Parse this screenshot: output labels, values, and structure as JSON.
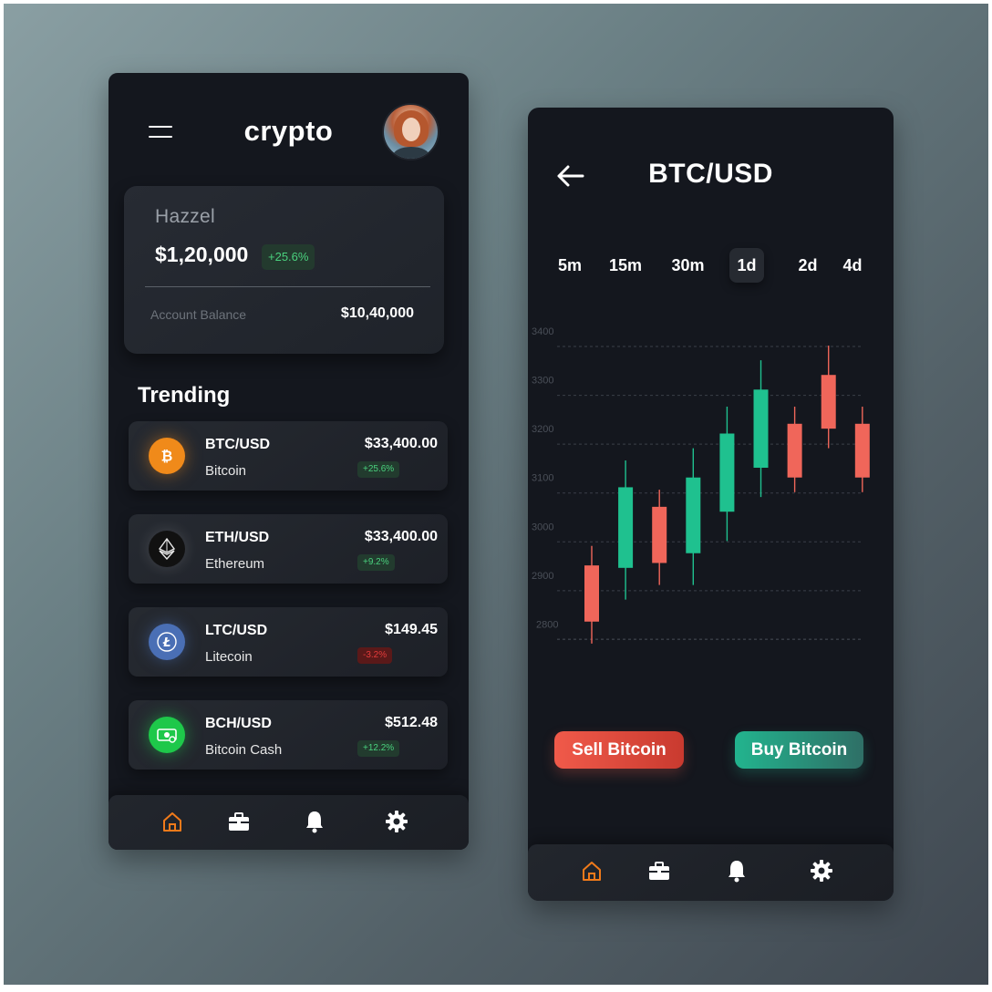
{
  "home": {
    "app_title": "crypto",
    "user_name": "Hazzel",
    "total_amount": "$1,20,000",
    "total_change": "+25.6%",
    "balance_label": "Account Balance",
    "balance_value": "$10,40,000",
    "section_title": "Trending",
    "coins": [
      {
        "pair": "BTC/USD",
        "name": "Bitcoin",
        "price": "$33,400.00",
        "change": "+25.6%",
        "direction": "up",
        "icon": "bitcoin-icon"
      },
      {
        "pair": "ETH/USD",
        "name": "Ethereum",
        "price": "$33,400.00",
        "change": "+9.2%",
        "direction": "up",
        "icon": "ethereum-icon"
      },
      {
        "pair": "LTC/USD",
        "name": "Litecoin",
        "price": "$149.45",
        "change": "-3.2%",
        "direction": "down",
        "icon": "litecoin-icon"
      },
      {
        "pair": "BCH/USD",
        "name": "Bitcoin Cash",
        "price": "$512.48",
        "change": "+12.2%",
        "direction": "up",
        "icon": "bitcoin-cash-icon"
      }
    ]
  },
  "detail": {
    "pair_title": "BTC/USD",
    "timeframes": [
      "5m",
      "15m",
      "30m",
      "1d",
      "2d",
      "4d"
    ],
    "active_timeframe": "1d",
    "sell_label": "Sell Bitcoin",
    "buy_label": "Buy Bitcoin"
  },
  "nav": {
    "items": [
      "home-icon",
      "briefcase-icon",
      "bell-icon",
      "gear-icon"
    ],
    "active": "home-icon"
  },
  "colors": {
    "accent": "#f07a1a",
    "up": "#1fc18f",
    "down": "#f0665a",
    "background": "#14171e"
  },
  "chart_data": {
    "type": "candlestick",
    "y_ticks": [
      3400,
      3300,
      3200,
      3100,
      3000,
      2900,
      2800
    ],
    "ylim": [
      2700,
      3400
    ],
    "grid": true,
    "candles": [
      {
        "open": 2805,
        "close": 2920,
        "high": 2960,
        "low": 2760,
        "direction": "down"
      },
      {
        "open": 2915,
        "close": 3080,
        "high": 3135,
        "low": 2850,
        "direction": "up"
      },
      {
        "open": 3040,
        "close": 2925,
        "high": 3075,
        "low": 2880,
        "direction": "down"
      },
      {
        "open": 2945,
        "close": 3100,
        "high": 3160,
        "low": 2880,
        "direction": "up"
      },
      {
        "open": 3030,
        "close": 3190,
        "high": 3245,
        "low": 2970,
        "direction": "up"
      },
      {
        "open": 3120,
        "close": 3280,
        "high": 3340,
        "low": 3060,
        "direction": "up"
      },
      {
        "open": 3210,
        "close": 3100,
        "high": 3245,
        "low": 3070,
        "direction": "down"
      },
      {
        "open": 3310,
        "close": 3200,
        "high": 3370,
        "low": 3160,
        "direction": "down"
      },
      {
        "open": 3210,
        "close": 3100,
        "high": 3245,
        "low": 3070,
        "direction": "down"
      }
    ]
  }
}
